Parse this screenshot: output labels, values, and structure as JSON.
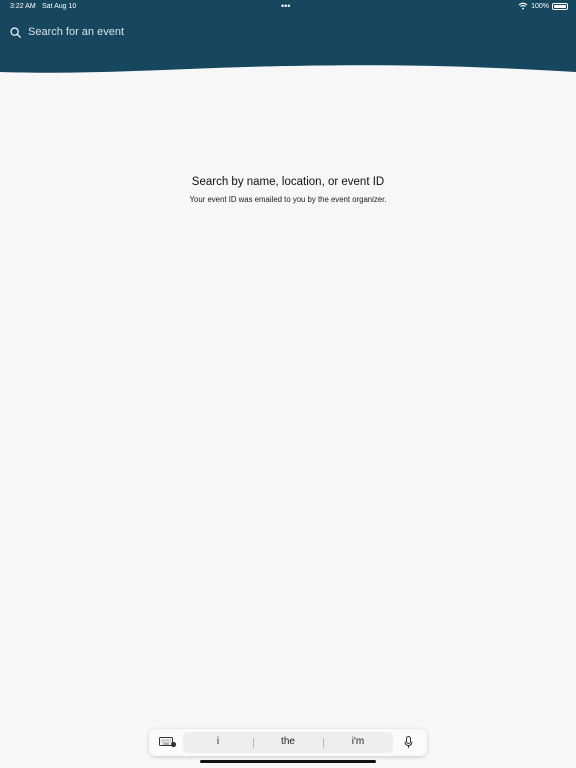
{
  "status_bar": {
    "time": "3:22 AM",
    "date": "Sat Aug 10",
    "multitask_dots": "•••",
    "battery_percent": "100%",
    "icons": [
      "wifi-icon",
      "battery-icon"
    ]
  },
  "header": {
    "search_placeholder": "Search for an event",
    "search_value": "",
    "icon": "search-icon",
    "background_color": "#16475f"
  },
  "empty_state": {
    "title": "Search by name, location, or event ID",
    "subtitle": "Your event ID was emailed to you by the event organizer."
  },
  "keyboard_bar": {
    "suggestions": [
      "i",
      "the",
      "i'm"
    ],
    "icons": [
      "keyboard-icon",
      "microphone-icon"
    ]
  }
}
